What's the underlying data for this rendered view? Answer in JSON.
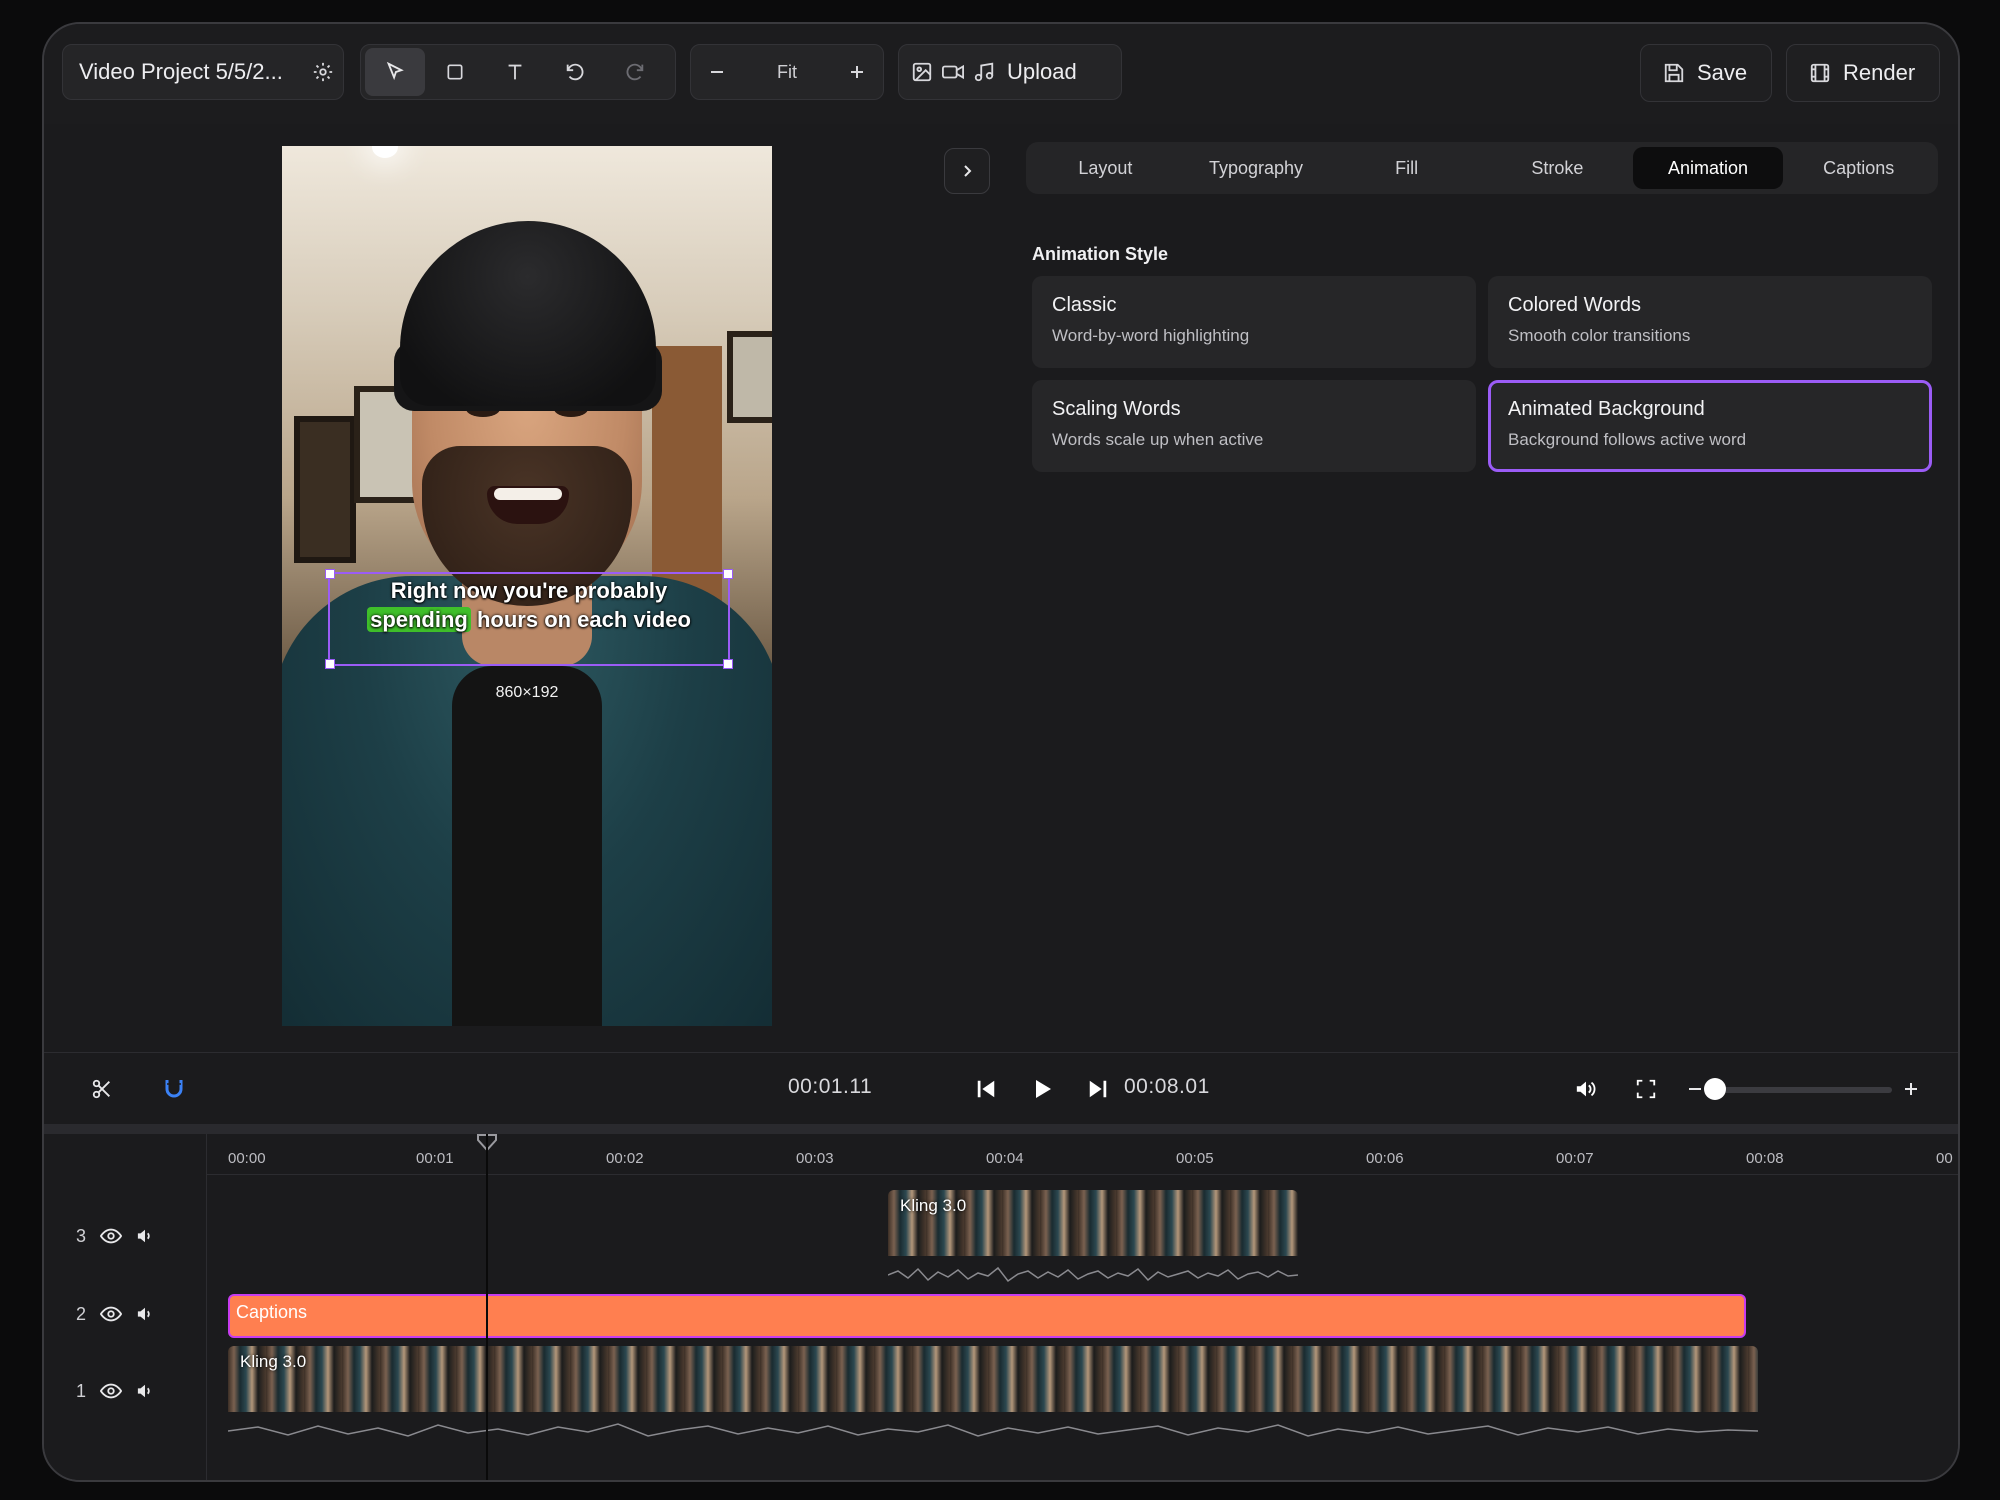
{
  "topbar": {
    "project_title": "Video Project 5/5/2...",
    "zoom_label": "Fit",
    "upload_label": "Upload",
    "save_label": "Save",
    "render_label": "Render"
  },
  "preview": {
    "caption_line1": "Right now you're probably",
    "caption_highlight": "spending",
    "caption_line2_rest": " hours on each video",
    "dimensions": "860×192"
  },
  "panel": {
    "tabs": [
      "Layout",
      "Typography",
      "Fill",
      "Stroke",
      "Animation",
      "Captions"
    ],
    "active_tab": "Animation",
    "section_title": "Animation Style",
    "styles": [
      {
        "title": "Classic",
        "desc": "Word-by-word highlighting"
      },
      {
        "title": "Colored Words",
        "desc": "Smooth color transitions"
      },
      {
        "title": "Scaling Words",
        "desc": "Words scale up when active"
      },
      {
        "title": "Animated Background",
        "desc": "Background follows active word"
      }
    ],
    "selected_style": "Animated Background"
  },
  "playback": {
    "current_time": "00:01.11",
    "total_time": "00:08.01"
  },
  "timeline": {
    "ruler": [
      "00:00",
      "00:01",
      "00:02",
      "00:03",
      "00:04",
      "00:05",
      "00:06",
      "00:07",
      "00:08",
      "00"
    ],
    "tracks": [
      {
        "number": "3",
        "clip_label": "Kling 3.0"
      },
      {
        "number": "2",
        "clip_label": "Captions"
      },
      {
        "number": "1",
        "clip_label": "Kling 3.0"
      }
    ]
  },
  "colors": {
    "accent": "#9b5cf6",
    "captions_clip": "#ff7f50",
    "highlight": "#3fbf2a",
    "magnet": "#3b82f6"
  }
}
